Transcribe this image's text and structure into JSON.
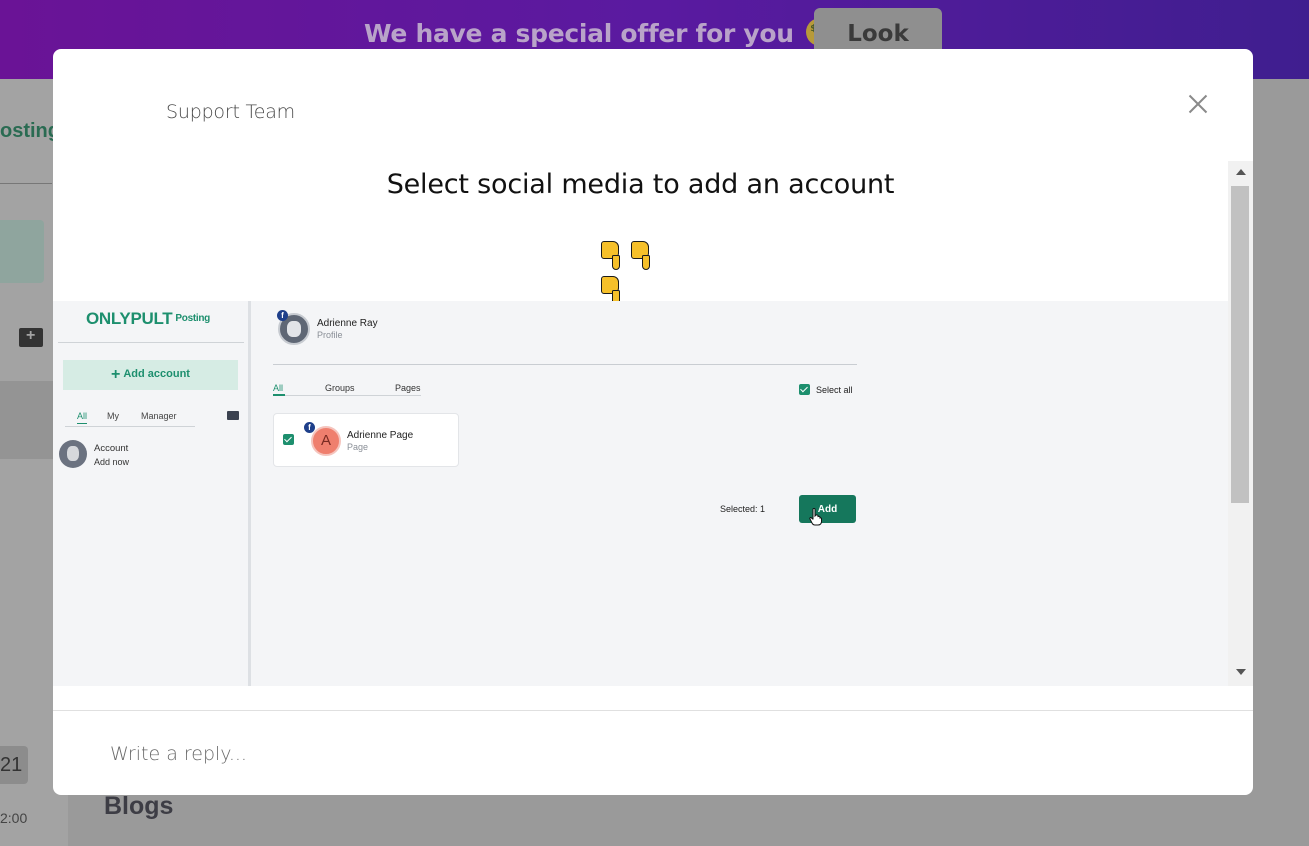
{
  "banner": {
    "text": "We have a special offer for you",
    "emoji": "money-mouth-face",
    "button_label": "Look"
  },
  "background": {
    "posting_fragment": "osting",
    "chip_text": "21",
    "time_fragment": "2:00",
    "blogs_heading": "Blogs"
  },
  "modal": {
    "title": "Support Team",
    "message_heading": "Select social media to add an account",
    "pointer_emoji": "backhand-index-pointing-down",
    "reply_placeholder": "Write a reply..."
  },
  "screenshot": {
    "logo": "ONLYPULT",
    "logo_sub": "Posting",
    "add_account_label": "Add account",
    "sidebar_tabs": [
      "All",
      "My",
      "Manager"
    ],
    "sidebar_account_name": "Account",
    "sidebar_account_sub": "Add now",
    "profile_name": "Adrienne Ray",
    "profile_sub": "Profile",
    "filter_tabs": [
      "All",
      "Groups",
      "Pages"
    ],
    "select_all_label": "Select all",
    "card_initial": "A",
    "card_name": "Adrienne Page",
    "card_sub": "Page",
    "selected_text": "Selected: 1",
    "add_button_label": "Add"
  },
  "colors": {
    "brand_green": "#1d8f6e",
    "banner_purple": "#5a1aa0"
  }
}
